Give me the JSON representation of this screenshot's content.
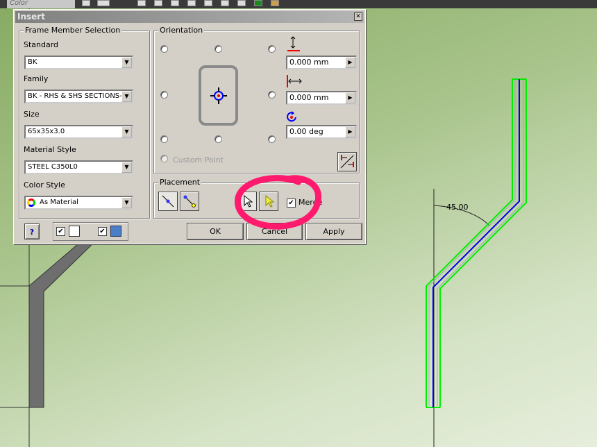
{
  "toolbar": {
    "color_box": "Color"
  },
  "drawing": {
    "angle_dimension": "45.00"
  },
  "dialog": {
    "title": "Insert",
    "frame_member_selection": {
      "label": "Frame Member Selection",
      "standard_label": "Standard",
      "standard_value": "BK",
      "family_label": "Family",
      "family_value": "BK - RHS & SHS SECTIONS-S",
      "size_label": "Size",
      "size_value": "65x35x3.0",
      "material_label": "Material Style",
      "material_value": "STEEL C350L0",
      "color_label": "Color Style",
      "color_value": "As Material"
    },
    "orientation": {
      "label": "Orientation",
      "vertical_offset": "0.000 mm",
      "horizontal_offset": "0.000 mm",
      "rotation": "0.00 deg",
      "custom_point_label": "Custom Point",
      "selected_point": "center"
    },
    "placement": {
      "label": "Placement",
      "merge_label": "Merge",
      "merge_checked": true
    },
    "buttons": {
      "ok": "OK",
      "cancel": "Cancel",
      "apply": "Apply"
    },
    "annotation_color": "#ff1a6e"
  }
}
